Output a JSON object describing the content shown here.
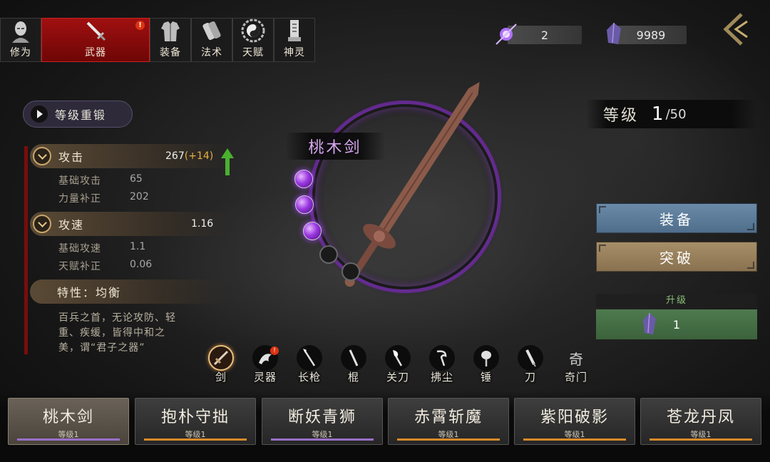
{
  "tabs": [
    {
      "label": "修为",
      "icon": "head-icon",
      "active": false
    },
    {
      "label": "武器",
      "icon": "sword-icon",
      "active": true,
      "badge": "!"
    },
    {
      "label": "装备",
      "icon": "armor-icon",
      "active": false
    },
    {
      "label": "法术",
      "icon": "scroll-icon",
      "active": false
    },
    {
      "label": "天赋",
      "icon": "yinyang-icon",
      "active": false
    },
    {
      "label": "神灵",
      "icon": "tablet-icon",
      "active": false
    }
  ],
  "currency": {
    "orb_value": "2",
    "crystal_value": "9989"
  },
  "reforge_label": "等级重锻",
  "stats": {
    "attack": {
      "label": "攻击",
      "value": "267",
      "bonus": "(+14)"
    },
    "base_attack": {
      "label": "基础攻击",
      "value": "65"
    },
    "strength": {
      "label": "力量补正",
      "value": "202"
    },
    "speed": {
      "label": "攻速",
      "value": "1.16"
    },
    "base_speed": {
      "label": "基础攻速",
      "value": "1.1"
    },
    "talent": {
      "label": "天赋补正",
      "value": "0.06"
    },
    "trait": "特性：均衡",
    "description": "百兵之首，无论攻防、轻重、疾缓，皆得中和之美，谓“君子之器”"
  },
  "weapon": {
    "name": "桃木剑",
    "orbs_total": 5,
    "orbs_filled": 3
  },
  "level": {
    "label": "等级",
    "current": "1",
    "max": "/50"
  },
  "buttons": {
    "equip": "装备",
    "breakthrough": "突破",
    "upgrade_title": "升级",
    "upgrade_cost": "1"
  },
  "weapon_types": [
    {
      "label": "剑",
      "selected": true
    },
    {
      "label": "灵器",
      "badge": "!"
    },
    {
      "label": "长枪"
    },
    {
      "label": "棍"
    },
    {
      "label": "关刀"
    },
    {
      "label": "拂尘"
    },
    {
      "label": "锤"
    },
    {
      "label": "刀"
    },
    {
      "label": "奇门"
    }
  ],
  "weapon_type_icon_glyph": "奇",
  "cards": [
    {
      "name": "桃木剑",
      "level": "等级1",
      "bar": "#9a70c8"
    },
    {
      "name": "抱朴守拙",
      "level": "等级1",
      "bar": "#d88a2a"
    },
    {
      "name": "断妖青狮",
      "level": "等级1",
      "bar": "#9a70c8"
    },
    {
      "name": "赤霄斩魔",
      "level": "等级1",
      "bar": "#d88a2a"
    },
    {
      "name": "紫阳破影",
      "level": "等级1",
      "bar": "#d88a2a"
    },
    {
      "name": "苍龙丹凤",
      "level": "等级1",
      "bar": "#d88a2a"
    }
  ],
  "colors": {
    "active_tab": "#a01010",
    "equip": "#5e7e9c",
    "breakthrough": "#9a8260",
    "upgrade": "#467046",
    "orb": "#9a38e0"
  }
}
